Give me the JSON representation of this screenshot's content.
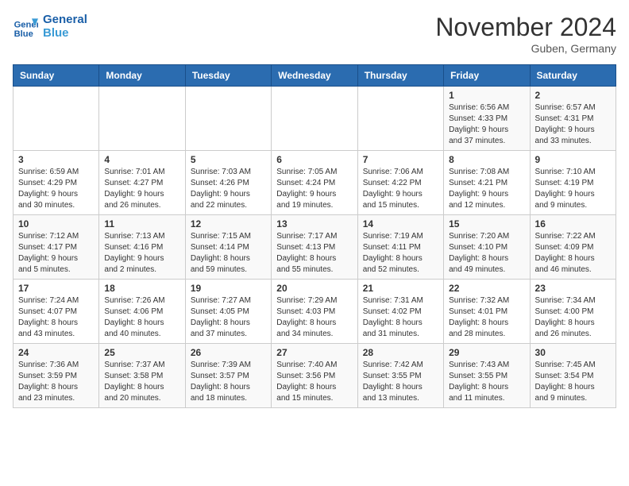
{
  "header": {
    "logo_line1": "General",
    "logo_line2": "Blue",
    "month": "November 2024",
    "location": "Guben, Germany"
  },
  "weekdays": [
    "Sunday",
    "Monday",
    "Tuesday",
    "Wednesday",
    "Thursday",
    "Friday",
    "Saturday"
  ],
  "weeks": [
    [
      {
        "day": "",
        "detail": ""
      },
      {
        "day": "",
        "detail": ""
      },
      {
        "day": "",
        "detail": ""
      },
      {
        "day": "",
        "detail": ""
      },
      {
        "day": "",
        "detail": ""
      },
      {
        "day": "1",
        "detail": "Sunrise: 6:56 AM\nSunset: 4:33 PM\nDaylight: 9 hours\nand 37 minutes."
      },
      {
        "day": "2",
        "detail": "Sunrise: 6:57 AM\nSunset: 4:31 PM\nDaylight: 9 hours\nand 33 minutes."
      }
    ],
    [
      {
        "day": "3",
        "detail": "Sunrise: 6:59 AM\nSunset: 4:29 PM\nDaylight: 9 hours\nand 30 minutes."
      },
      {
        "day": "4",
        "detail": "Sunrise: 7:01 AM\nSunset: 4:27 PM\nDaylight: 9 hours\nand 26 minutes."
      },
      {
        "day": "5",
        "detail": "Sunrise: 7:03 AM\nSunset: 4:26 PM\nDaylight: 9 hours\nand 22 minutes."
      },
      {
        "day": "6",
        "detail": "Sunrise: 7:05 AM\nSunset: 4:24 PM\nDaylight: 9 hours\nand 19 minutes."
      },
      {
        "day": "7",
        "detail": "Sunrise: 7:06 AM\nSunset: 4:22 PM\nDaylight: 9 hours\nand 15 minutes."
      },
      {
        "day": "8",
        "detail": "Sunrise: 7:08 AM\nSunset: 4:21 PM\nDaylight: 9 hours\nand 12 minutes."
      },
      {
        "day": "9",
        "detail": "Sunrise: 7:10 AM\nSunset: 4:19 PM\nDaylight: 9 hours\nand 9 minutes."
      }
    ],
    [
      {
        "day": "10",
        "detail": "Sunrise: 7:12 AM\nSunset: 4:17 PM\nDaylight: 9 hours\nand 5 minutes."
      },
      {
        "day": "11",
        "detail": "Sunrise: 7:13 AM\nSunset: 4:16 PM\nDaylight: 9 hours\nand 2 minutes."
      },
      {
        "day": "12",
        "detail": "Sunrise: 7:15 AM\nSunset: 4:14 PM\nDaylight: 8 hours\nand 59 minutes."
      },
      {
        "day": "13",
        "detail": "Sunrise: 7:17 AM\nSunset: 4:13 PM\nDaylight: 8 hours\nand 55 minutes."
      },
      {
        "day": "14",
        "detail": "Sunrise: 7:19 AM\nSunset: 4:11 PM\nDaylight: 8 hours\nand 52 minutes."
      },
      {
        "day": "15",
        "detail": "Sunrise: 7:20 AM\nSunset: 4:10 PM\nDaylight: 8 hours\nand 49 minutes."
      },
      {
        "day": "16",
        "detail": "Sunrise: 7:22 AM\nSunset: 4:09 PM\nDaylight: 8 hours\nand 46 minutes."
      }
    ],
    [
      {
        "day": "17",
        "detail": "Sunrise: 7:24 AM\nSunset: 4:07 PM\nDaylight: 8 hours\nand 43 minutes."
      },
      {
        "day": "18",
        "detail": "Sunrise: 7:26 AM\nSunset: 4:06 PM\nDaylight: 8 hours\nand 40 minutes."
      },
      {
        "day": "19",
        "detail": "Sunrise: 7:27 AM\nSunset: 4:05 PM\nDaylight: 8 hours\nand 37 minutes."
      },
      {
        "day": "20",
        "detail": "Sunrise: 7:29 AM\nSunset: 4:03 PM\nDaylight: 8 hours\nand 34 minutes."
      },
      {
        "day": "21",
        "detail": "Sunrise: 7:31 AM\nSunset: 4:02 PM\nDaylight: 8 hours\nand 31 minutes."
      },
      {
        "day": "22",
        "detail": "Sunrise: 7:32 AM\nSunset: 4:01 PM\nDaylight: 8 hours\nand 28 minutes."
      },
      {
        "day": "23",
        "detail": "Sunrise: 7:34 AM\nSunset: 4:00 PM\nDaylight: 8 hours\nand 26 minutes."
      }
    ],
    [
      {
        "day": "24",
        "detail": "Sunrise: 7:36 AM\nSunset: 3:59 PM\nDaylight: 8 hours\nand 23 minutes."
      },
      {
        "day": "25",
        "detail": "Sunrise: 7:37 AM\nSunset: 3:58 PM\nDaylight: 8 hours\nand 20 minutes."
      },
      {
        "day": "26",
        "detail": "Sunrise: 7:39 AM\nSunset: 3:57 PM\nDaylight: 8 hours\nand 18 minutes."
      },
      {
        "day": "27",
        "detail": "Sunrise: 7:40 AM\nSunset: 3:56 PM\nDaylight: 8 hours\nand 15 minutes."
      },
      {
        "day": "28",
        "detail": "Sunrise: 7:42 AM\nSunset: 3:55 PM\nDaylight: 8 hours\nand 13 minutes."
      },
      {
        "day": "29",
        "detail": "Sunrise: 7:43 AM\nSunset: 3:55 PM\nDaylight: 8 hours\nand 11 minutes."
      },
      {
        "day": "30",
        "detail": "Sunrise: 7:45 AM\nSunset: 3:54 PM\nDaylight: 8 hours\nand 9 minutes."
      }
    ]
  ]
}
